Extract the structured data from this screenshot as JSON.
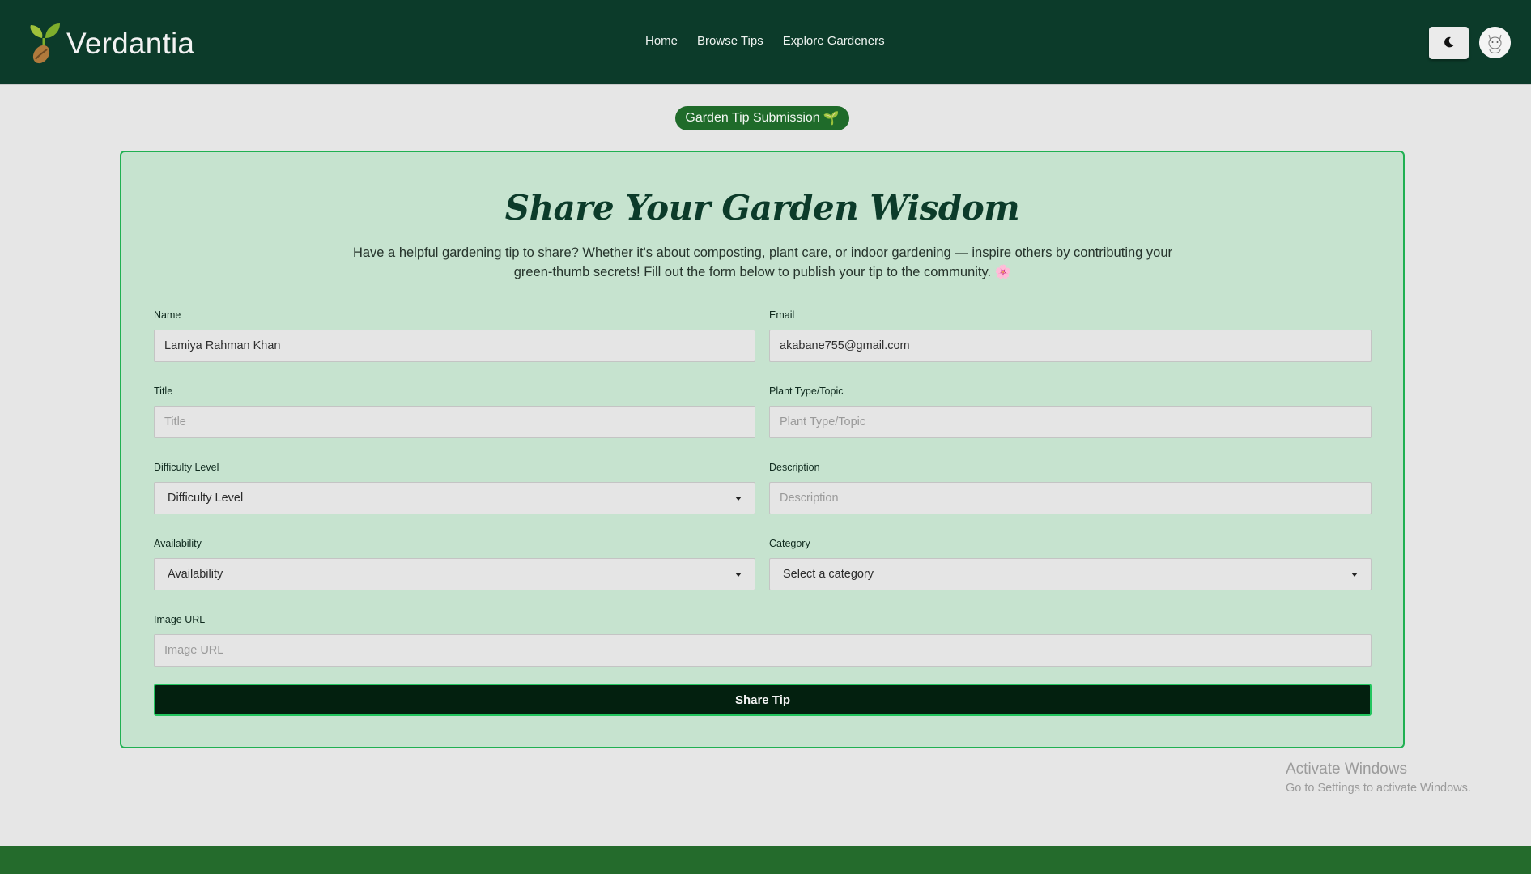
{
  "header": {
    "brand": "Verdantia",
    "nav": [
      "Home",
      "Browse Tips",
      "Explore Gardeners"
    ],
    "theme_icon": "moon-icon",
    "avatar_icon": "cat-avatar"
  },
  "badge": {
    "label": "Garden Tip Submission",
    "icon": "🌱"
  },
  "form": {
    "title": "Share Your Garden Wisdom",
    "description": "Have a helpful gardening tip to share? Whether it's about composting, plant care, or indoor gardening — inspire others by contributing your green-thumb secrets! Fill out the form below to publish your tip to the community. 🌸",
    "fields": {
      "name": {
        "label": "Name",
        "value": "Lamiya Rahman Khan"
      },
      "email": {
        "label": "Email",
        "value": "akabane755@gmail.com"
      },
      "title": {
        "label": "Title",
        "placeholder": "Title"
      },
      "plant_type": {
        "label": "Plant Type/Topic",
        "placeholder": "Plant Type/Topic"
      },
      "difficulty": {
        "label": "Difficulty Level",
        "selected": "Difficulty Level"
      },
      "description": {
        "label": "Description",
        "placeholder": "Description"
      },
      "availability": {
        "label": "Availability",
        "selected": "Availability"
      },
      "category": {
        "label": "Category",
        "selected": "Select a category"
      },
      "image_url": {
        "label": "Image URL",
        "placeholder": "Image URL"
      }
    },
    "submit_label": "Share Tip"
  },
  "watermark": {
    "line1": "Activate Windows",
    "line2": "Go to Settings to activate Windows."
  },
  "colors": {
    "header_bg": "#0c3b2a",
    "card_bg": "#c6e3cf",
    "card_border": "#20b052",
    "button_bg": "#03200f",
    "badge_bg": "#1f6b2a",
    "footer_bg": "#246b2c"
  }
}
